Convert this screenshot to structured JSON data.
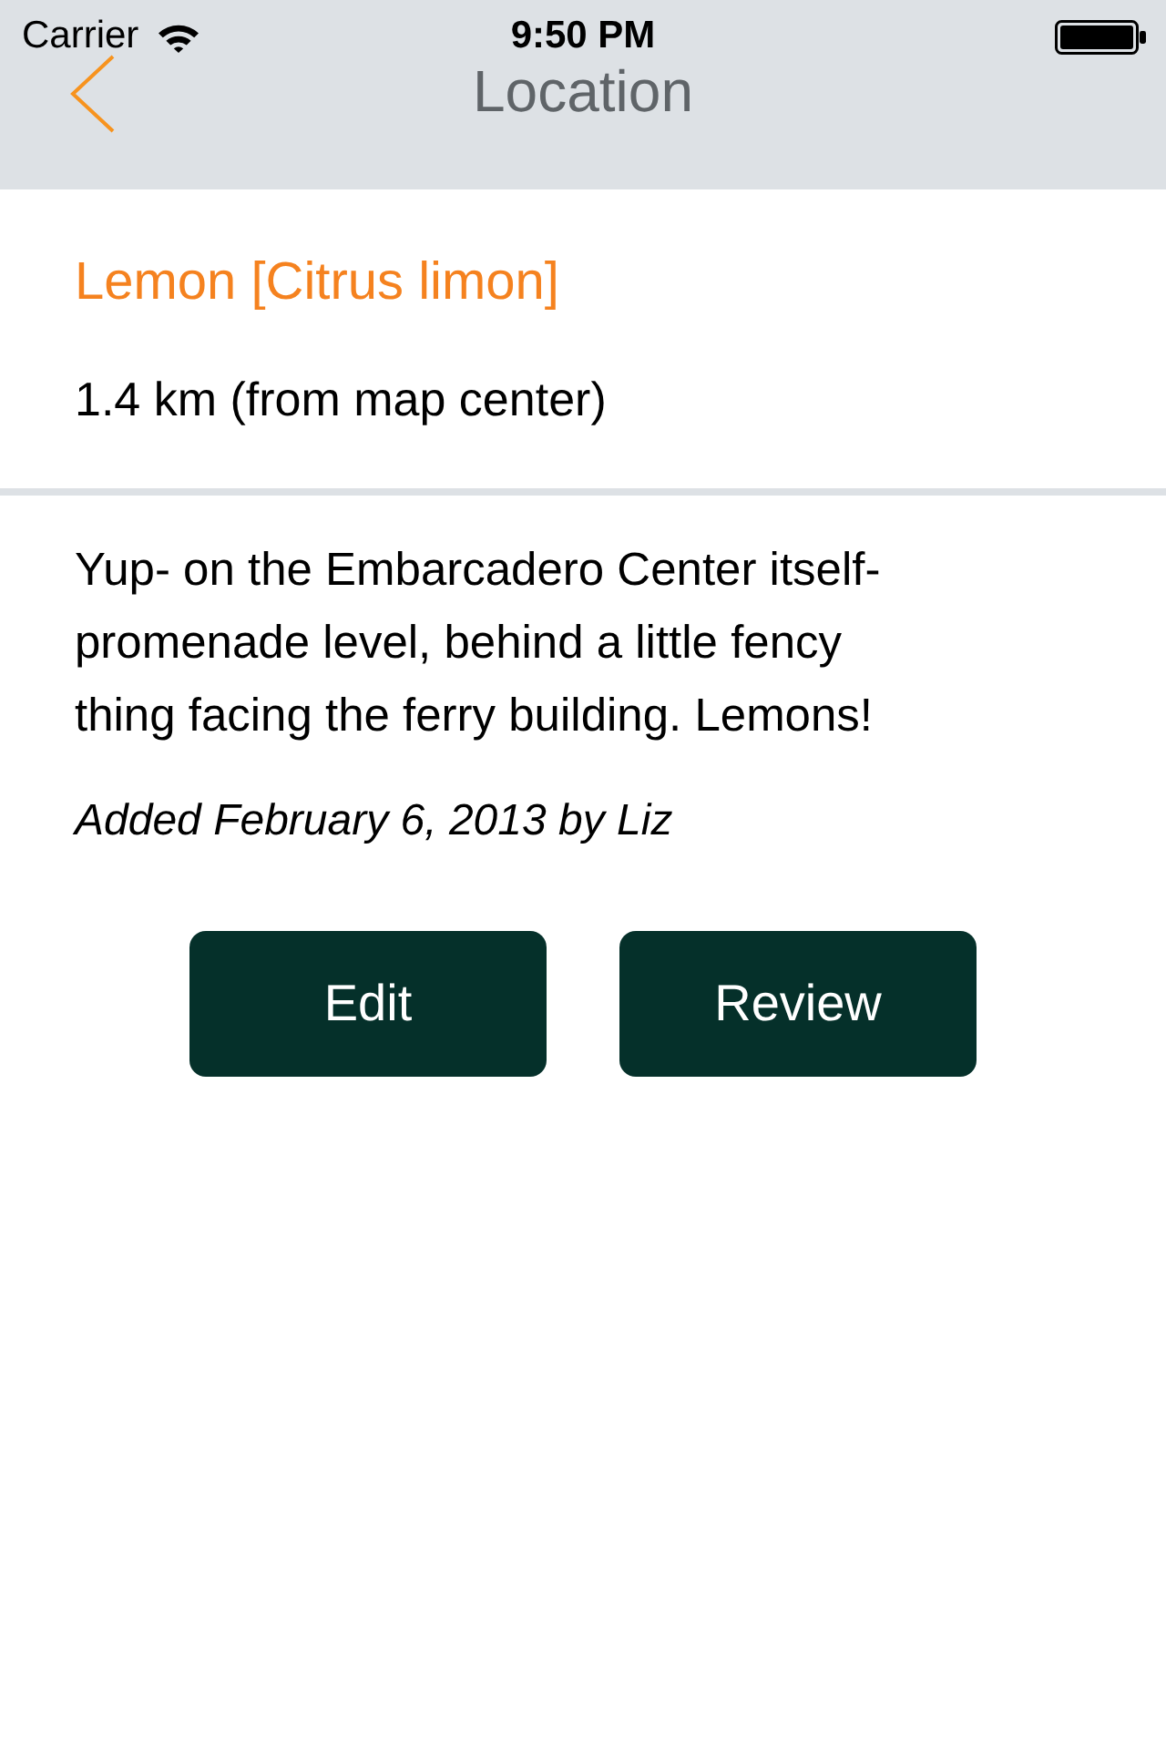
{
  "status_bar": {
    "carrier": "Carrier",
    "time": "9:50 PM"
  },
  "nav_bar": {
    "title": "Location"
  },
  "plant": {
    "name": "Lemon [Citrus limon]",
    "distance": "1.4 km (from map center)"
  },
  "note": {
    "text": "Yup- on the Embarcadero Center itself- promenade level, behind a little fency thing facing the ferry building. Lemons!",
    "added": "Added February 6, 2013 by Liz"
  },
  "buttons": [
    {
      "label": "Edit"
    },
    {
      "label": "Review"
    }
  ]
}
